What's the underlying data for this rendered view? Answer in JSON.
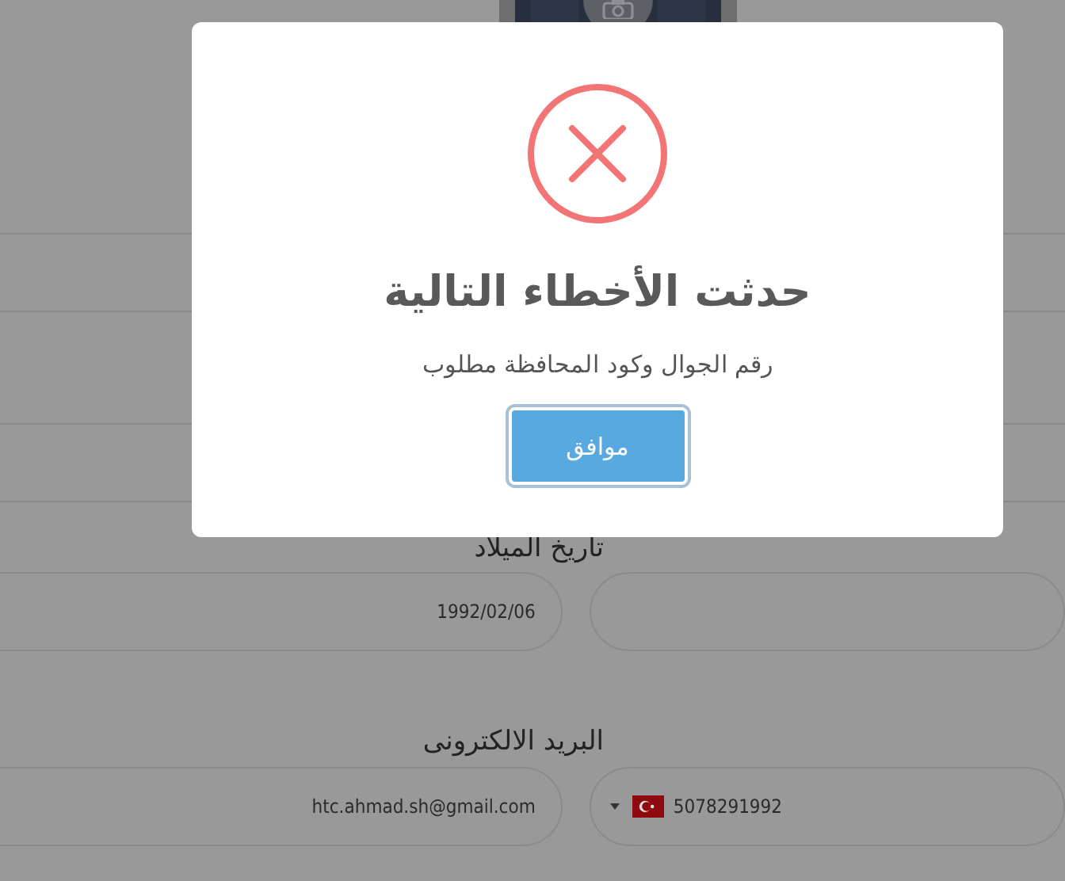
{
  "form_rows": [
    {
      "fields": [
        {
          "kind": "text"
        },
        {
          "kind": "text"
        }
      ]
    },
    {
      "fields": [
        {
          "kind": "text"
        },
        {
          "kind": "text"
        }
      ]
    },
    {
      "label": "تاريخ الميلاد",
      "fields": [
        {
          "kind": "text"
        },
        {
          "kind": "text",
          "value": "1992/02/06"
        }
      ]
    },
    {
      "label": "البريد الالكترونى",
      "fields": [
        {
          "kind": "phone",
          "value": "5078291992"
        },
        {
          "kind": "text",
          "value": "htc.ahmad.sh@gmail.com"
        }
      ]
    }
  ],
  "dialog": {
    "kind": "error",
    "title": "حدثت الأخطاء التالية",
    "message": "رقم الجوال وكود المحافظة مطلوب",
    "button": "موافق"
  }
}
